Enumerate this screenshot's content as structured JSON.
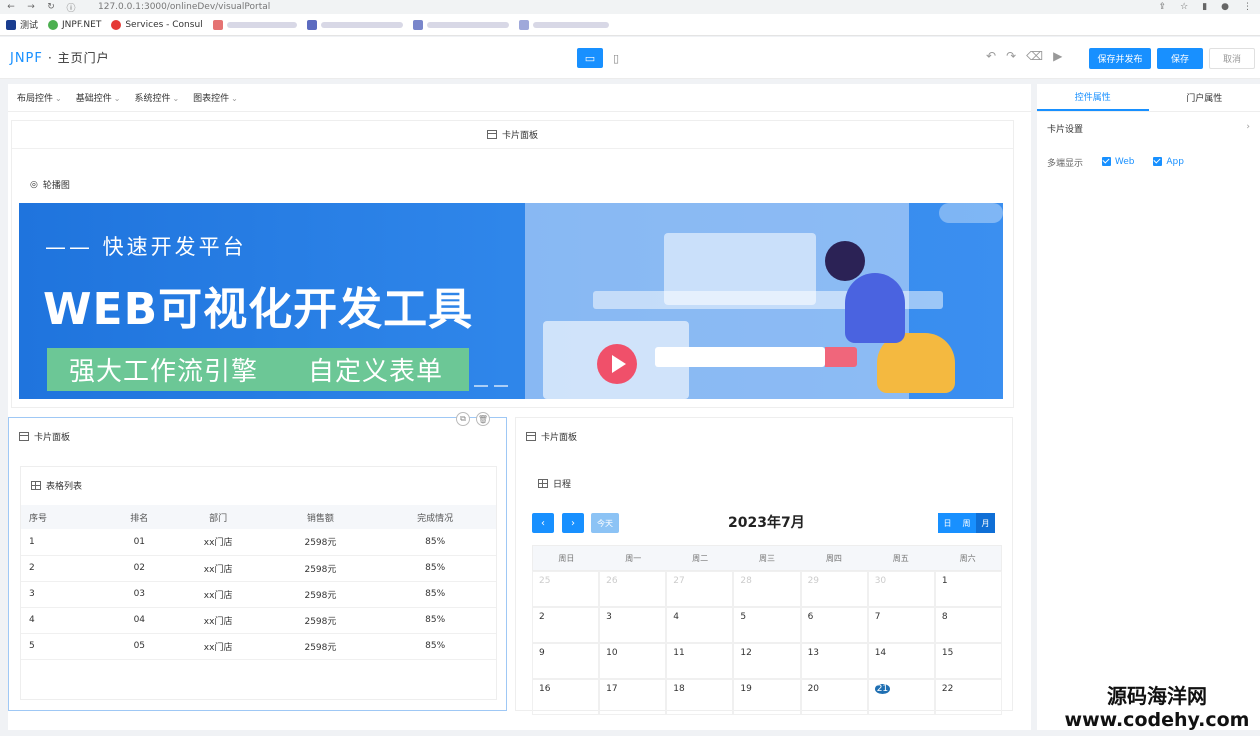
{
  "browser": {
    "url": "127.0.0.1:3000/onlineDev/visualPortal",
    "bookmarks": [
      "测试",
      "JNPF.NET",
      "Services - Consul"
    ]
  },
  "header": {
    "logo": "JNPF",
    "title": "· 主页门户",
    "buttons": {
      "save_publish": "保存并发布",
      "save": "保存",
      "cancel": "取消"
    }
  },
  "toolbar": {
    "items": [
      "布局控件",
      "基础控件",
      "系统控件",
      "图表控件"
    ]
  },
  "canvas": {
    "top_card_title": "卡片面板",
    "carousel_label": "轮播图",
    "banner": {
      "line1": "—— 快速开发平台",
      "line2": "WEB可视化开发工具",
      "tag1": "强大工作流引擎",
      "tag2": "自定义表单"
    },
    "left_card": {
      "title": "卡片面板",
      "table_title": "表格列表",
      "columns": [
        "序号",
        "排名",
        "部门",
        "销售额",
        "完成情况"
      ],
      "rows": [
        [
          "1",
          "01",
          "xx门店",
          "2598元",
          "85%"
        ],
        [
          "2",
          "02",
          "xx门店",
          "2598元",
          "85%"
        ],
        [
          "3",
          "03",
          "xx门店",
          "2598元",
          "85%"
        ],
        [
          "4",
          "04",
          "xx门店",
          "2598元",
          "85%"
        ],
        [
          "5",
          "05",
          "xx门店",
          "2598元",
          "85%"
        ]
      ]
    },
    "right_card": {
      "title": "卡片面板",
      "schedule_title": "日程",
      "today": "今天",
      "month_title": "2023年7月",
      "views": [
        "日",
        "周",
        "月"
      ],
      "weekdays": [
        "周日",
        "周一",
        "周二",
        "周三",
        "周四",
        "周五",
        "周六"
      ],
      "weeks": [
        [
          "25",
          "26",
          "27",
          "28",
          "29",
          "30",
          "1"
        ],
        [
          "2",
          "3",
          "4",
          "5",
          "6",
          "7",
          "8"
        ],
        [
          "9",
          "10",
          "11",
          "12",
          "13",
          "14",
          "15"
        ],
        [
          "16",
          "17",
          "18",
          "19",
          "20",
          "21",
          "22"
        ]
      ]
    }
  },
  "properties": {
    "tabs": [
      "控件属性",
      "门户属性"
    ],
    "card_settings": "卡片设置",
    "multi_display": "多端显示",
    "options": [
      "Web",
      "App"
    ]
  },
  "watermark": {
    "line1": "源码海洋网",
    "line2": "www.codehy.com"
  }
}
